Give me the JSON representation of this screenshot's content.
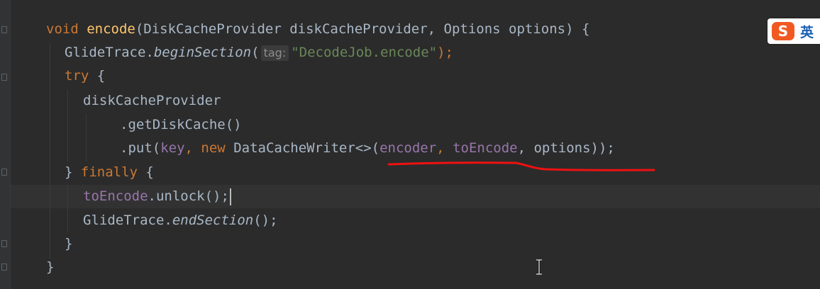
{
  "editor": {
    "lines": [
      [
        "void",
        " ",
        "encode",
        "(DiskCacheProvider diskCacheProvider, Options options) {"
      ],
      [
        "GlideTrace.",
        "beginSection",
        "(",
        "tag:",
        "\"DecodeJob.encode\"",
        ");"
      ],
      [
        "try",
        " {"
      ],
      [
        "diskCacheProvider"
      ],
      [
        ".getDiskCache()"
      ],
      [
        ".put(",
        "key",
        ", ",
        "new",
        " DataCacheWriter<>(",
        "encoder",
        ", ",
        "toEncode",
        ", options));"
      ],
      [
        "} ",
        "finally",
        " {"
      ],
      [
        "toEncode",
        ".unlock();"
      ],
      [
        "GlideTrace.",
        "endSection",
        "();"
      ],
      [
        "}"
      ],
      [
        "}"
      ]
    ]
  },
  "ime": {
    "logo": "S",
    "mode_label": "英"
  },
  "annotation": {
    "color": "#ee1111"
  },
  "colors": {
    "background": "#2b2b2b",
    "keyword": "#cc7832",
    "method": "#ffc66d",
    "string": "#6a8759",
    "field": "#9876aa",
    "text": "#a9b7c6"
  }
}
